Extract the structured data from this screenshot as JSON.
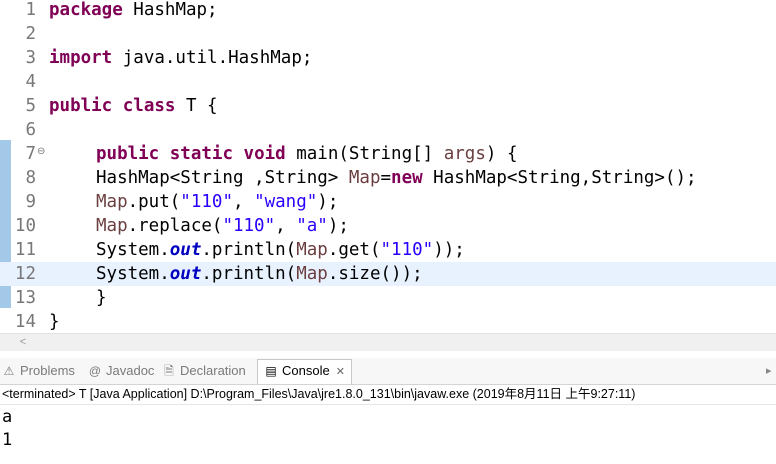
{
  "editor": {
    "lines": [
      {
        "num": "1",
        "tokens": [
          {
            "t": "package",
            "c": "kw"
          },
          {
            "t": " HashMap;"
          }
        ]
      },
      {
        "num": "2",
        "tokens": []
      },
      {
        "num": "3",
        "tokens": [
          {
            "t": "import",
            "c": "kw"
          },
          {
            "t": " java.util.HashMap;"
          }
        ]
      },
      {
        "num": "4",
        "tokens": []
      },
      {
        "num": "5",
        "tokens": [
          {
            "t": "public",
            "c": "kw"
          },
          {
            "t": " "
          },
          {
            "t": "class",
            "c": "kw"
          },
          {
            "t": " T {"
          }
        ]
      },
      {
        "num": "6",
        "tokens": []
      },
      {
        "num": "7",
        "fold": "⊖",
        "indent": 1,
        "tokens": [
          {
            "t": "public",
            "c": "kw"
          },
          {
            "t": " "
          },
          {
            "t": "static",
            "c": "kw"
          },
          {
            "t": " "
          },
          {
            "t": "void",
            "c": "kw"
          },
          {
            "t": " main(String[] "
          },
          {
            "t": "args",
            "c": "var"
          },
          {
            "t": ") {"
          }
        ]
      },
      {
        "num": "8",
        "indent": 1,
        "tokens": [
          {
            "t": "HashMap<String ,String> "
          },
          {
            "t": "Map",
            "c": "var"
          },
          {
            "t": "="
          },
          {
            "t": "new",
            "c": "kw"
          },
          {
            "t": " HashMap<String,String>();"
          }
        ]
      },
      {
        "num": "9",
        "indent": 1,
        "tokens": [
          {
            "t": "Map",
            "c": "var"
          },
          {
            "t": ".put("
          },
          {
            "t": "\"110\"",
            "c": "str"
          },
          {
            "t": ", "
          },
          {
            "t": "\"wang\"",
            "c": "str"
          },
          {
            "t": ");"
          }
        ]
      },
      {
        "num": "10",
        "indent": 1,
        "tokens": [
          {
            "t": "Map",
            "c": "var"
          },
          {
            "t": ".replace("
          },
          {
            "t": "\"110\"",
            "c": "str"
          },
          {
            "t": ", "
          },
          {
            "t": "\"a\"",
            "c": "str"
          },
          {
            "t": ");"
          }
        ]
      },
      {
        "num": "11",
        "indent": 1,
        "tokens": [
          {
            "t": "System."
          },
          {
            "t": "out",
            "c": "sfld"
          },
          {
            "t": ".println("
          },
          {
            "t": "Map",
            "c": "var"
          },
          {
            "t": ".get("
          },
          {
            "t": "\"110\"",
            "c": "str"
          },
          {
            "t": "));"
          }
        ]
      },
      {
        "num": "12",
        "indent": 1,
        "current": true,
        "tokens": [
          {
            "t": "System."
          },
          {
            "t": "out",
            "c": "sfld"
          },
          {
            "t": ".println("
          },
          {
            "t": "Map",
            "c": "var"
          },
          {
            "t": ".size());"
          }
        ]
      },
      {
        "num": "13",
        "indent": 1,
        "tokens": [
          {
            "t": "}"
          }
        ]
      },
      {
        "num": "14",
        "tokens": [
          {
            "t": "}"
          }
        ]
      }
    ]
  },
  "scrollbar": {
    "left_arrow": "<"
  },
  "tabs": [
    {
      "icon": "⚠",
      "icon_name": "problems-icon",
      "label": "Problems",
      "active": false
    },
    {
      "icon": "@",
      "icon_name": "javadoc-icon",
      "label": "Javadoc",
      "active": false
    },
    {
      "icon": "🗎",
      "icon_name": "declaration-icon",
      "label": "Declaration",
      "active": false
    },
    {
      "icon": "▤",
      "icon_name": "console-icon",
      "label": "Console",
      "active": true,
      "close": "✕"
    }
  ],
  "console": {
    "status": "<terminated> T [Java Application] D:\\Program_Files\\Java\\jre1.8.0_131\\bin\\javaw.exe (2019年8月11日 上午9:27:11)",
    "output": [
      "a",
      "1"
    ]
  },
  "colors": {
    "keyword": "#7f0055",
    "string": "#2a00ff",
    "static_field": "#0000c0",
    "local_variable": "#6a3e3e",
    "current_line": "#e8f2fe",
    "ruler": "#5a9bd5"
  }
}
